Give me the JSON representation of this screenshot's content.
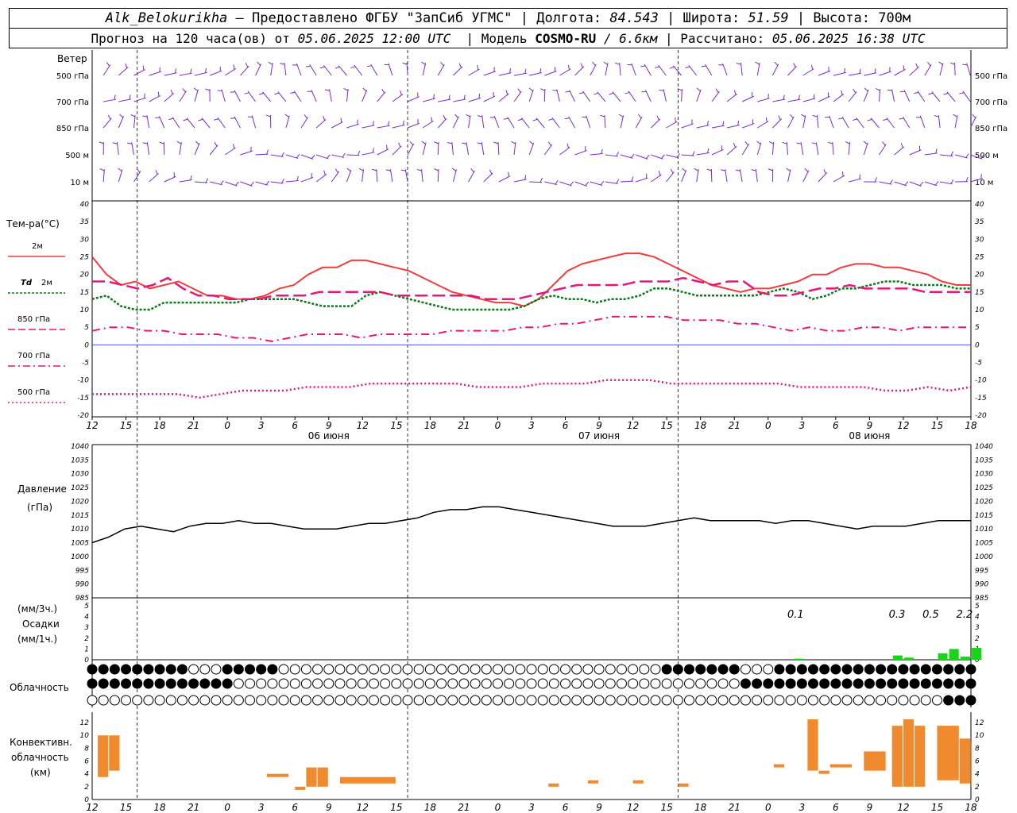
{
  "header": {
    "station": "Alk_Belokurikha",
    "provider": "– Предоставлено ФГБУ \"ЗапСиб УГМС\"",
    "lon_label": "Долгота:",
    "lon_value": "84.543",
    "lat_label": "Широта:",
    "lat_value": "51.59",
    "alt_label": "Высота:",
    "alt_value": "700м",
    "forecast_prefix": "Прогноз на 120 часа(ов) от",
    "forecast_time": "05.06.2025 12:00 UTC",
    "model_label": "Модель",
    "model_name": "COSMO-RU",
    "model_res": "/ 6.6км",
    "calc_label": "Рассчитано:",
    "calc_time": "05.06.2025 16:38 UTC"
  },
  "labels": {
    "wind": "Ветер",
    "wind_levels": [
      "500 гПа",
      "700 гПа",
      "850 гПа",
      "500 м",
      "10 м"
    ],
    "temp": "Тем-ра(°С)",
    "t2m": "2м",
    "td": "Td",
    "td2m": "2м",
    "t850": "850 гПа",
    "t700": "700 гПа",
    "t500": "500 гПа",
    "pressure": "Давление",
    "pressure_unit": "(гПа)",
    "precip_3h": "(мм/3ч.)",
    "precip": "Осадки",
    "precip_1h": "(мм/1ч.)",
    "cloud": "Облачность",
    "conv1": "Конвективн.",
    "conv2": "облачность",
    "conv3": "(км)"
  },
  "colors": {
    "t2m": "#f03c3c",
    "td2m": "#0b7a16",
    "t850": "#e8157a",
    "t700": "#e8157a",
    "t500": "#e8157a",
    "wind": "#7a2ad8",
    "pressure": "#000000",
    "precip": "#17d617",
    "conv": "#ef8a2e",
    "zero_line": "#3a3aff"
  },
  "time_axis": {
    "ticks": [
      "12",
      "15",
      "18",
      "21",
      "0",
      "3",
      "6",
      "9",
      "12",
      "15",
      "18",
      "21",
      "0",
      "3",
      "6",
      "9",
      "12",
      "15",
      "18",
      "21",
      "0",
      "3",
      "6",
      "9",
      "12",
      "15",
      "18"
    ],
    "dates": [
      "06 июня",
      "07 июня",
      "08 июня"
    ]
  },
  "chart_data": [
    {
      "type": "line",
      "title": "Тем-ра(°С)",
      "ylim": [
        -20,
        40
      ],
      "ylabel": "Тем-ра(°С)",
      "x_hours": [
        0,
        1,
        2,
        3,
        4,
        5,
        6,
        7,
        8,
        9,
        10,
        11,
        12,
        13,
        14,
        15,
        16,
        17,
        18,
        19,
        20,
        21,
        22,
        23,
        24,
        25,
        26,
        27,
        28,
        29,
        30,
        31,
        32,
        33,
        34,
        35,
        36,
        37,
        38,
        39,
        40,
        41,
        42,
        43,
        44,
        45,
        46,
        47,
        48,
        49,
        50,
        51,
        52,
        53,
        54,
        55,
        56,
        57,
        58,
        59,
        60,
        61,
        62,
        63,
        64,
        65,
        66,
        67,
        68,
        69,
        70,
        71,
        72,
        73,
        74,
        75,
        76,
        77,
        78
      ],
      "series": [
        {
          "name": "2м",
          "values": [
            25,
            20,
            17,
            18,
            16,
            17,
            18,
            16,
            14,
            14,
            13,
            13,
            14,
            16,
            17,
            20,
            22,
            22,
            24,
            24,
            23,
            22,
            21,
            19,
            17,
            15,
            14,
            13,
            12,
            12,
            11,
            13,
            17,
            21,
            23,
            24,
            25,
            26,
            26,
            25,
            23,
            21,
            19,
            17,
            16,
            15,
            16,
            16,
            17,
            18,
            20,
            20,
            22,
            23,
            23,
            22,
            22,
            21,
            20,
            18,
            17,
            17
          ]
        },
        {
          "name": "Td 2м",
          "values": [
            13,
            14,
            11,
            10,
            10,
            12,
            12,
            12,
            12,
            12,
            12,
            13,
            13,
            13,
            13,
            12,
            11,
            11,
            11,
            14,
            15,
            14,
            13,
            12,
            11,
            10,
            10,
            10,
            10,
            10,
            11,
            13,
            14,
            13,
            13,
            12,
            13,
            13,
            14,
            16,
            16,
            15,
            14,
            14,
            14,
            14,
            14,
            15,
            16,
            15,
            13,
            14,
            16,
            16,
            17,
            18,
            18,
            17,
            17,
            17,
            16,
            16
          ]
        },
        {
          "name": "850 гПа",
          "values": [
            18,
            18,
            17,
            16,
            17,
            19,
            16,
            14,
            14,
            13,
            13,
            13,
            14,
            14,
            14,
            15,
            15,
            15,
            15,
            15,
            14,
            14,
            14,
            14,
            14,
            14,
            13,
            13,
            13,
            14,
            15,
            16,
            17,
            17,
            17,
            17,
            18,
            18,
            18,
            19,
            18,
            17,
            18,
            18,
            15,
            14,
            14,
            15,
            16,
            16,
            17,
            16,
            16,
            16,
            16,
            15,
            15,
            15,
            15
          ]
        },
        {
          "name": "700 гПа",
          "values": [
            4,
            5,
            5,
            4,
            4,
            3,
            3,
            3,
            2,
            2,
            1,
            2,
            3,
            3,
            3,
            2,
            3,
            3,
            3,
            3,
            4,
            4,
            4,
            4,
            5,
            5,
            6,
            6,
            7,
            8,
            8,
            8,
            8,
            7,
            7,
            7,
            6,
            6,
            5,
            4,
            5,
            4,
            4,
            5,
            5,
            4,
            5,
            5,
            5,
            5
          ]
        },
        {
          "name": "500 гПа",
          "values": [
            -14,
            -14,
            -14,
            -14,
            -14,
            -15,
            -14,
            -13,
            -13,
            -13,
            -12,
            -12,
            -12,
            -11,
            -11,
            -11,
            -11,
            -11,
            -12,
            -12,
            -12,
            -11,
            -11,
            -11,
            -10,
            -10,
            -10,
            -11,
            -11,
            -11,
            -11,
            -11,
            -11,
            -12,
            -12,
            -12,
            -12,
            -13,
            -13,
            -12,
            -13,
            -12
          ]
        }
      ]
    },
    {
      "type": "line",
      "title": "Давление",
      "ylabel": "(гПа)",
      "ylim": [
        985,
        1040
      ],
      "series": [
        {
          "name": "Давление",
          "values": [
            1005,
            1007,
            1010,
            1011,
            1010,
            1009,
            1011,
            1012,
            1012,
            1013,
            1012,
            1012,
            1011,
            1010,
            1010,
            1010,
            1011,
            1012,
            1012,
            1013,
            1014,
            1016,
            1017,
            1017,
            1018,
            1018,
            1017,
            1016,
            1015,
            1014,
            1013,
            1012,
            1011,
            1011,
            1011,
            1012,
            1013,
            1014,
            1013,
            1013,
            1013,
            1013,
            1012,
            1013,
            1013,
            1012,
            1011,
            1010,
            1011,
            1011,
            1011,
            1012,
            1013,
            1013,
            1013
          ]
        }
      ]
    },
    {
      "type": "bar",
      "title": "Осадки",
      "ylim": [
        0,
        5
      ],
      "totals_3h": [
        {
          "hour": 3,
          "value": "0.1"
        },
        {
          "hour": 12,
          "value": "0.3"
        },
        {
          "hour": 15,
          "value": "0.5"
        },
        {
          "hour": 18,
          "value": "2.2"
        }
      ],
      "bars_1h": [
        {
          "x": 2.7,
          "value": 0.1
        },
        {
          "x": 11.5,
          "value": 0.4
        },
        {
          "x": 12.5,
          "value": 0.2
        },
        {
          "x": 15.5,
          "value": 0.6
        },
        {
          "x": 16.5,
          "value": 1.0
        },
        {
          "x": 17.5,
          "value": 0.3
        },
        {
          "x": 18.5,
          "value": 1.1
        }
      ]
    },
    {
      "type": "bar",
      "title": "Конвективн. облачность",
      "ylabel": "(км)",
      "ylim": [
        0,
        13
      ],
      "bars": [
        {
          "x0": 0.5,
          "x1": 1.5,
          "low": 3.5,
          "high": 10
        },
        {
          "x0": 1.5,
          "x1": 2.5,
          "low": 4.5,
          "high": 10
        },
        {
          "x0": 15.5,
          "x1": 17.5,
          "low": 3.5,
          "high": 4
        },
        {
          "x0": 18,
          "x1": 19,
          "low": 1.5,
          "high": 2
        },
        {
          "x0": 19,
          "x1": 20,
          "low": 2,
          "high": 5
        },
        {
          "x0": 20,
          "x1": 21,
          "low": 2,
          "high": 5
        },
        {
          "x0": 22,
          "x1": 27,
          "low": 2.5,
          "high": 3.5
        },
        {
          "x0": 40.5,
          "x1": 41.5,
          "low": 2,
          "high": 2.5
        },
        {
          "x0": 44,
          "x1": 45,
          "low": 2.5,
          "high": 3
        },
        {
          "x0": 48,
          "x1": 49,
          "low": 2.5,
          "high": 3
        },
        {
          "x0": 52,
          "x1": 53,
          "low": 2,
          "high": 2.5
        },
        {
          "x0": 60.5,
          "x1": 61.5,
          "low": 5,
          "high": 5.5
        },
        {
          "x0": 63.5,
          "x1": 64.5,
          "low": 4.5,
          "high": 12.5
        },
        {
          "x0": 64.5,
          "x1": 65.5,
          "low": 4,
          "high": 4.5
        },
        {
          "x0": 65.5,
          "x1": 67.5,
          "low": 5,
          "high": 5.5
        },
        {
          "x0": 68.5,
          "x1": 70.5,
          "low": 4.5,
          "high": 7.5
        },
        {
          "x0": 71,
          "x1": 72,
          "low": 2,
          "high": 11.5
        },
        {
          "x0": 72,
          "x1": 73,
          "low": 2,
          "high": 12.5
        },
        {
          "x0": 73,
          "x1": 74,
          "low": 2,
          "high": 11.5
        },
        {
          "x0": 75,
          "x1": 77,
          "low": 3,
          "high": 11.5
        },
        {
          "x0": 77,
          "x1": 78,
          "low": 2.5,
          "high": 9.5
        },
        {
          "x0": 78,
          "x1": 79.5,
          "low": 2,
          "high": 9
        }
      ]
    }
  ]
}
